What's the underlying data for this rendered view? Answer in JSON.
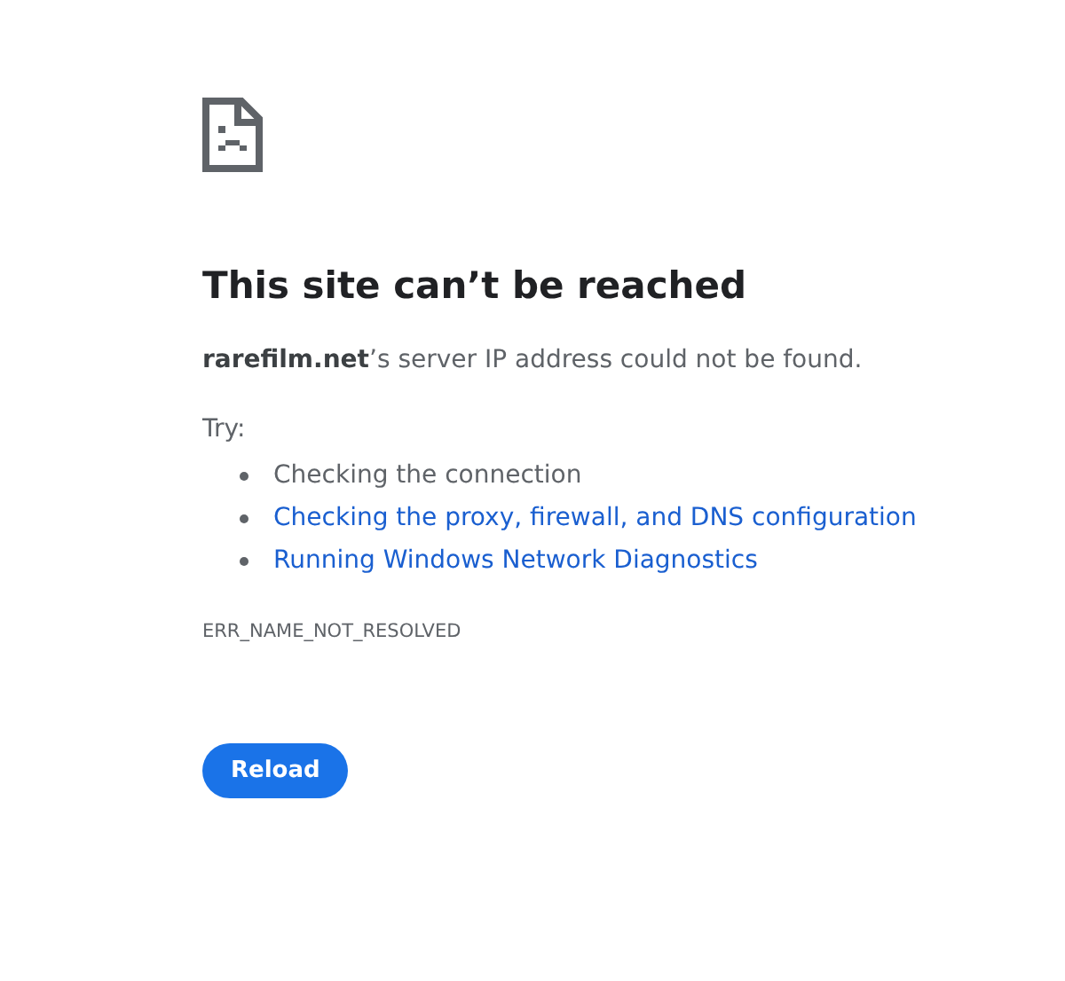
{
  "heading": "This site can’t be reached",
  "message": "**rarefilm.net**’s server IP address could not be found.",
  "try_label": "Try:",
  "suggestions": [
    {
      "kind": "text",
      "text": "Checking the connection"
    },
    {
      "kind": "link",
      "text": "Checking the proxy, firewall, and DNS configuration"
    },
    {
      "kind": "link",
      "text": "Running Windows Network Diagnostics"
    }
  ],
  "error_code": "ERR_NAME_NOT_RESOLVED",
  "button": "Reload"
}
